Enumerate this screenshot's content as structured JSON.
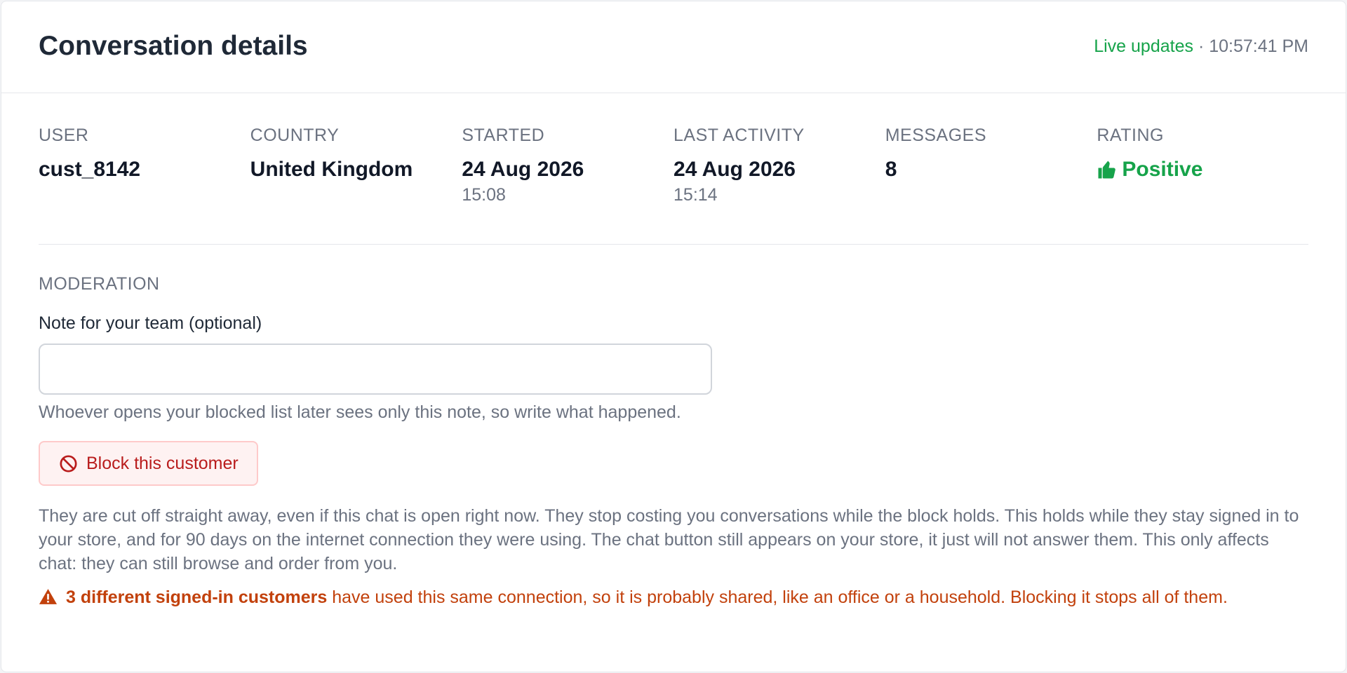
{
  "header": {
    "title": "Conversation details",
    "live_label": "Live updates",
    "separator": "·",
    "time": "10:57:41 PM"
  },
  "stats": [
    {
      "label": "USER",
      "value": "cust_8142",
      "sub": ""
    },
    {
      "label": "COUNTRY",
      "value": "United Kingdom",
      "sub": ""
    },
    {
      "label": "STARTED",
      "value": "24 Aug 2026",
      "sub": "15:08"
    },
    {
      "label": "LAST ACTIVITY",
      "value": "24 Aug 2026",
      "sub": "15:14"
    },
    {
      "label": "MESSAGES",
      "value": "8",
      "sub": ""
    },
    {
      "label": "RATING",
      "value": "Positive",
      "icon": "thumbs-up-icon",
      "color": "#16a34a"
    }
  ],
  "moderation": {
    "section_label": "MODERATION",
    "note_label": "Note for your team (optional)",
    "note_value": "",
    "note_placeholder": "",
    "help_text": "Whoever opens your blocked list later sees only this note, so write what happened.",
    "block_button": {
      "label": "Block this customer",
      "icon": "ban-icon",
      "color": "#b91c1c"
    },
    "explanation": "They are cut off straight away, even if this chat is open right now. They stop costing you conversations while the block holds. This holds while they stay signed in to your store, and for 90 days on the internet connection they were using. The chat button still appears on your store, it just will not answer them. This only affects chat: they can still browse and order from you.",
    "warning": {
      "icon": "warning-icon",
      "emphasis": "3 different signed-in customers",
      "text": " have used this same connection, so it is probably shared, like an office or a household. Blocking it stops all of them.",
      "color": "#c2410c"
    }
  }
}
